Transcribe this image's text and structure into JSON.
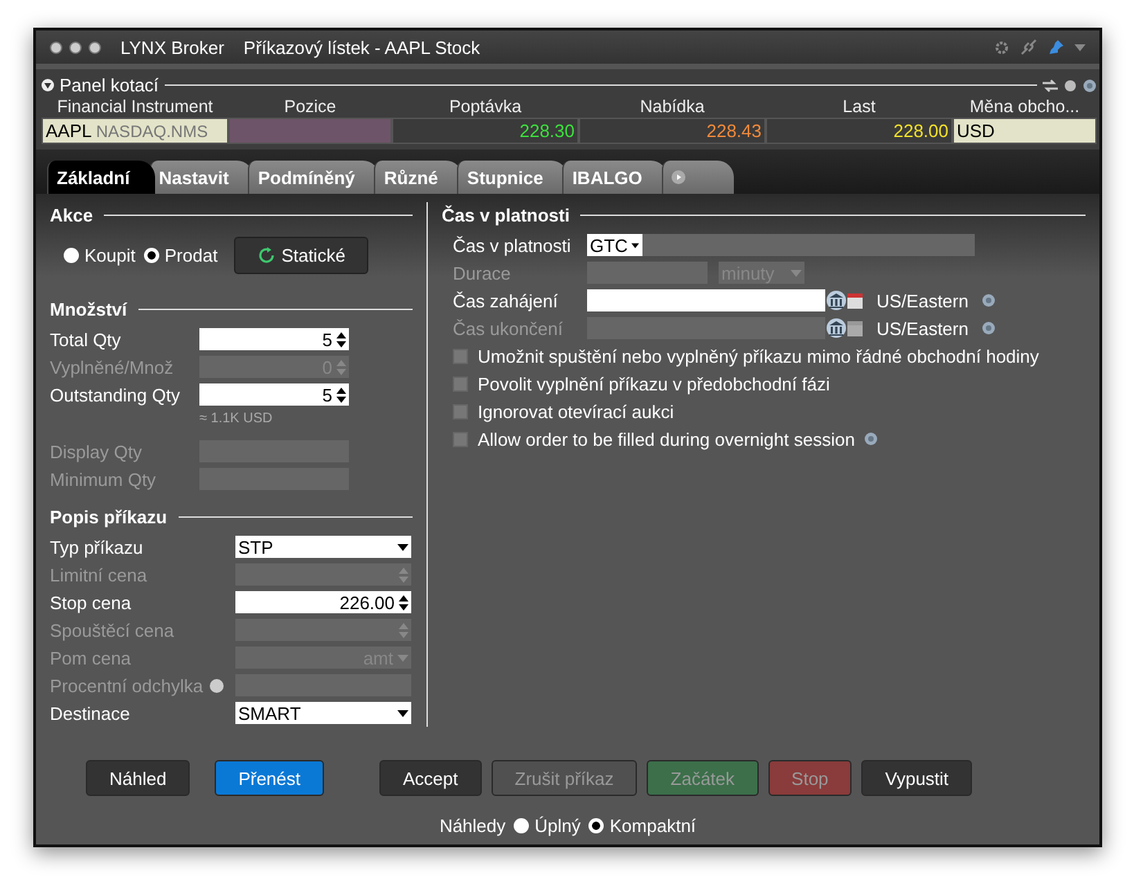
{
  "window": {
    "app": "LYNX Broker",
    "title": "Příkazový lístek - AAPL Stock"
  },
  "quote_panel": {
    "title": "Panel kotací",
    "expanded": true,
    "columns": [
      "Financial Instrument",
      "Pozice",
      "Poptávka",
      "Nabídka",
      "Last",
      "Měna obcho..."
    ],
    "row": {
      "symbol": "AAPL",
      "exchange": "NASDAQ.NMS",
      "bid": "228.30",
      "ask": "228.43",
      "last": "228.00",
      "currency": "USD"
    }
  },
  "tabs": [
    {
      "kind": "text",
      "label": "Základní",
      "selected": true
    },
    {
      "kind": "text",
      "label": "Nastavit",
      "selected": false
    },
    {
      "kind": "text",
      "label": "Podmíněný",
      "selected": false
    },
    {
      "kind": "text",
      "label": "Různé",
      "selected": false
    },
    {
      "kind": "text",
      "label": "Stupnice",
      "selected": false
    },
    {
      "kind": "text",
      "label": "IBALGO",
      "selected": false
    },
    {
      "kind": "icon",
      "selected": false
    }
  ],
  "action": {
    "title": "Akce",
    "options": [
      {
        "label": "Koupit",
        "selected": false
      },
      {
        "label": "Prodat",
        "selected": true
      }
    ],
    "button": "Statické"
  },
  "quantity": {
    "title": "Množství",
    "rows": [
      {
        "kind": "spin",
        "label": "Total Qty",
        "value": "5",
        "disabled": false
      },
      {
        "kind": "spin",
        "label": "Vyplněné/Množ",
        "value": "0",
        "disabled": true
      },
      {
        "kind": "spin",
        "label": "Outstanding Qty",
        "value": "5",
        "disabled": false
      },
      {
        "kind": "note",
        "label": "≈ 1.1K USD"
      },
      {
        "kind": "text",
        "label": "Display Qty",
        "disabled": true
      },
      {
        "kind": "text",
        "label": "Minimum Qty",
        "disabled": true
      }
    ]
  },
  "order": {
    "title": "Popis příkazu",
    "rows": [
      {
        "kind": "select",
        "label": "Typ příkazu",
        "value": "STP",
        "disabled": false
      },
      {
        "kind": "spin",
        "label": "Limitní cena",
        "disabled": true
      },
      {
        "kind": "spin",
        "label": "Stop cena",
        "value": "226.00",
        "disabled": false
      },
      {
        "kind": "spin",
        "label": "Spouštěcí cena",
        "disabled": true
      },
      {
        "kind": "select",
        "label": "Pom cena",
        "value": "amt",
        "disabled": true
      },
      {
        "kind": "text",
        "label": "Procentní odchylka",
        "disabled": true,
        "info": true
      },
      {
        "kind": "select",
        "label": "Destinace",
        "value": "SMART",
        "disabled": false
      }
    ]
  },
  "validity": {
    "title": "Čas v platnosti",
    "rows": [
      {
        "kind": "tif",
        "label": "Čas v platnosti",
        "value": "GTC",
        "disabled": false
      },
      {
        "kind": "duration",
        "label": "Durace",
        "unit": "minuty",
        "disabled": true
      },
      {
        "kind": "datetime",
        "label": "Čas zahájení",
        "timezone": "US/Eastern",
        "disabled": false
      },
      {
        "kind": "datetime",
        "label": "Čas ukončení",
        "timezone": "US/Eastern",
        "disabled": true
      }
    ],
    "checkboxes": [
      {
        "label": "Umožnit spuštění nebo vyplněný příkazu mimo řádné obchodní hodiny",
        "checked": false,
        "help": false
      },
      {
        "label": "Povolit vyplnění příkazu v předobchodní fázi",
        "checked": false,
        "help": false
      },
      {
        "label": "Ignorovat otevírací aukci",
        "checked": false,
        "help": false
      },
      {
        "label": "Allow order to be filled during overnight session",
        "checked": false,
        "help": true
      }
    ]
  },
  "button_groups": [
    [
      {
        "label": "Náhled",
        "kind": "default",
        "disabled": false
      }
    ],
    [
      {
        "label": "Přenést",
        "kind": "primary",
        "disabled": false
      }
    ],
    [
      {
        "label": "Accept",
        "kind": "default",
        "disabled": false
      },
      {
        "label": "Zrušit příkaz",
        "kind": "default",
        "disabled": true
      },
      {
        "label": "Začátek",
        "kind": "success",
        "disabled": true
      },
      {
        "label": "Stop",
        "kind": "danger",
        "disabled": true
      },
      {
        "label": "Vypustit",
        "kind": "default",
        "disabled": false
      }
    ]
  ],
  "views": {
    "label": "Náhledy",
    "options": [
      {
        "label": "Úplný",
        "selected": false
      },
      {
        "label": "Kompaktní",
        "selected": true
      }
    ]
  }
}
